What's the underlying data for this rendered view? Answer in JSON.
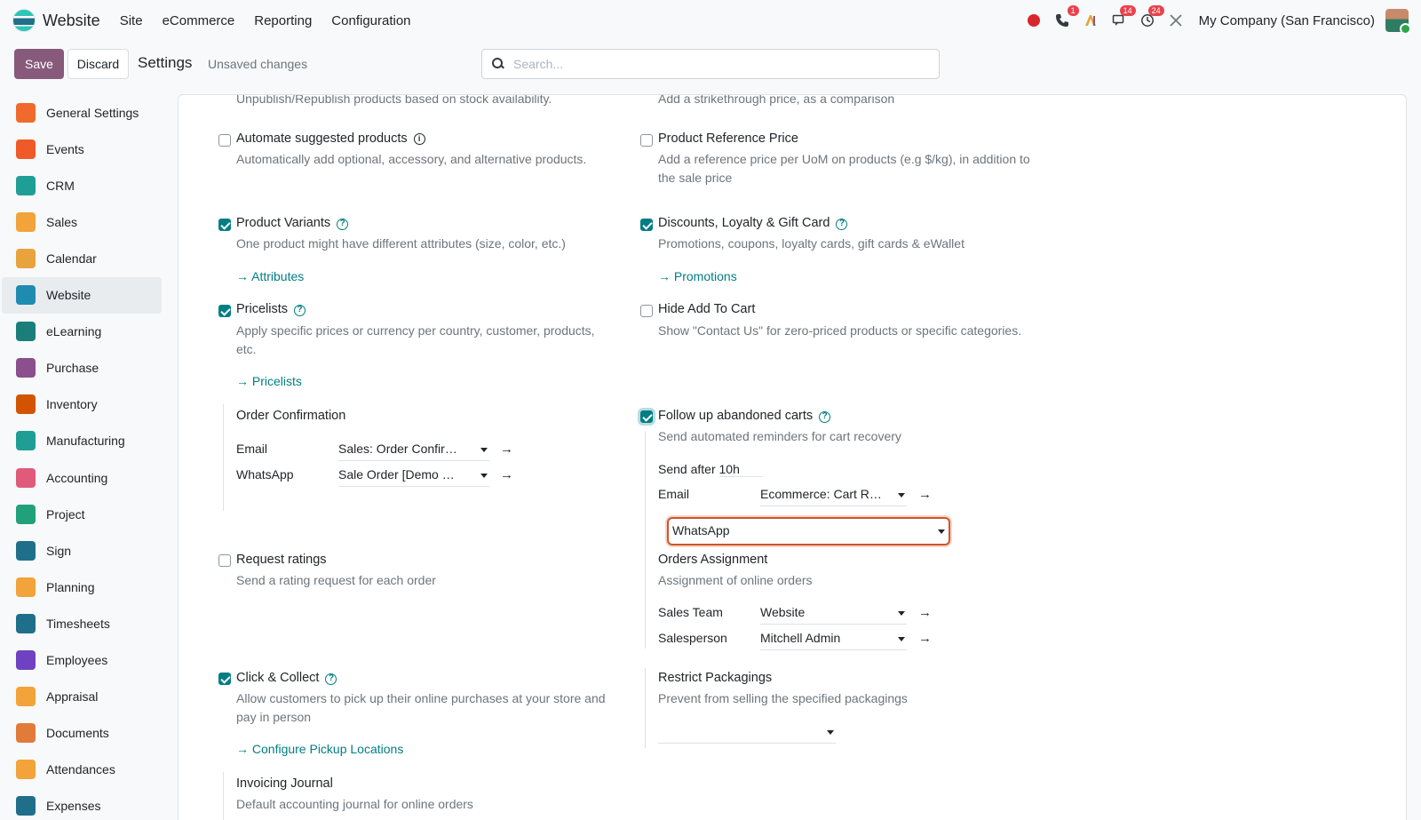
{
  "app": {
    "name": "Website",
    "menu": [
      "Site",
      "eCommerce",
      "Reporting",
      "Configuration"
    ],
    "systray": {
      "phone_badge": "1",
      "messages_badge": "14",
      "activities_badge": "24",
      "company": "My Company (San Francisco)"
    }
  },
  "control": {
    "save_label": "Save",
    "discard_label": "Discard",
    "title": "Settings",
    "unsaved": "Unsaved changes",
    "search_placeholder": "Search..."
  },
  "sidebar": {
    "items": [
      {
        "label": "General Settings",
        "color": "#f06a2b"
      },
      {
        "label": "Events",
        "color": "#f05a28"
      },
      {
        "label": "CRM",
        "color": "#1f9e95"
      },
      {
        "label": "Sales",
        "color": "#f2a33a"
      },
      {
        "label": "Calendar",
        "color": "#e8a33c"
      },
      {
        "label": "Website",
        "color": "#1f8bb0"
      },
      {
        "label": "eLearning",
        "color": "#1a7f7a"
      },
      {
        "label": "Purchase",
        "color": "#8a4f8c"
      },
      {
        "label": "Inventory",
        "color": "#d35400"
      },
      {
        "label": "Manufacturing",
        "color": "#1f9e95"
      },
      {
        "label": "Accounting",
        "color": "#e05a7a"
      },
      {
        "label": "Project",
        "color": "#21a179"
      },
      {
        "label": "Sign",
        "color": "#1f6f8b"
      },
      {
        "label": "Planning",
        "color": "#f2a33a"
      },
      {
        "label": "Timesheets",
        "color": "#1f6f8b"
      },
      {
        "label": "Employees",
        "color": "#6f42c1"
      },
      {
        "label": "Appraisal",
        "color": "#f2a33a"
      },
      {
        "label": "Documents",
        "color": "#e07b39"
      },
      {
        "label": "Attendances",
        "color": "#f2a33a"
      },
      {
        "label": "Expenses",
        "color": "#1f6f8b"
      }
    ],
    "active": "Website"
  },
  "settings": {
    "cut_left": "Unpublish/Republish products based on stock availability.",
    "cut_right": "Add a strikethrough price, as a comparison",
    "automate": {
      "title": "Automate suggested products",
      "desc": "Automatically add optional, accessory, and alternative products.",
      "checked": false
    },
    "reference_price": {
      "title": "Product Reference Price",
      "desc": "Add a reference price per UoM on products (e.g $/kg), in addition to the sale price",
      "checked": false
    },
    "variants": {
      "title": "Product Variants",
      "desc": "One product might have different attributes (size, color, etc.)",
      "link": "Attributes",
      "checked": true
    },
    "discounts": {
      "title": "Discounts, Loyalty & Gift Card",
      "desc": "Promotions, coupons, loyalty cards, gift cards & eWallet",
      "link": "Promotions",
      "checked": true
    },
    "pricelists": {
      "title": "Pricelists",
      "desc": "Apply specific prices or currency per country, customer, products, etc.",
      "link": "Pricelists",
      "checked": true
    },
    "hide_cart": {
      "title": "Hide Add To Cart",
      "desc": "Show \"Contact Us\" for zero-priced products or specific categories.",
      "checked": false
    },
    "order_confirmation": {
      "title": "Order Confirmation",
      "email_label": "Email",
      "email_value": "Sales: Order Confir…",
      "whatsapp_label": "WhatsApp",
      "whatsapp_value": "Sale Order [Demo …"
    },
    "abandoned": {
      "title": "Follow up abandoned carts",
      "desc": "Send automated reminders for cart recovery",
      "send_after_label": "Send after",
      "send_after_value": "10h",
      "email_label": "Email",
      "email_value": "Ecommerce: Cart R…",
      "whatsapp_label": "WhatsApp",
      "whatsapp_value": "",
      "checked": true
    },
    "ratings": {
      "title": "Request ratings",
      "desc": "Send a rating request for each order",
      "checked": false
    },
    "orders_assignment": {
      "title": "Orders Assignment",
      "desc": "Assignment of online orders",
      "team_label": "Sales Team",
      "team_value": "Website",
      "person_label": "Salesperson",
      "person_value": "Mitchell Admin"
    },
    "click_collect": {
      "title": "Click & Collect",
      "desc": "Allow customers to pick up their online purchases at your store and pay in person",
      "link": "Configure Pickup Locations",
      "checked": true
    },
    "packagings": {
      "title": "Restrict Packagings",
      "desc": "Prevent from selling the specified packagings",
      "value": ""
    },
    "invoicing": {
      "title": "Invoicing Journal",
      "desc": "Default accounting journal for online orders"
    }
  }
}
